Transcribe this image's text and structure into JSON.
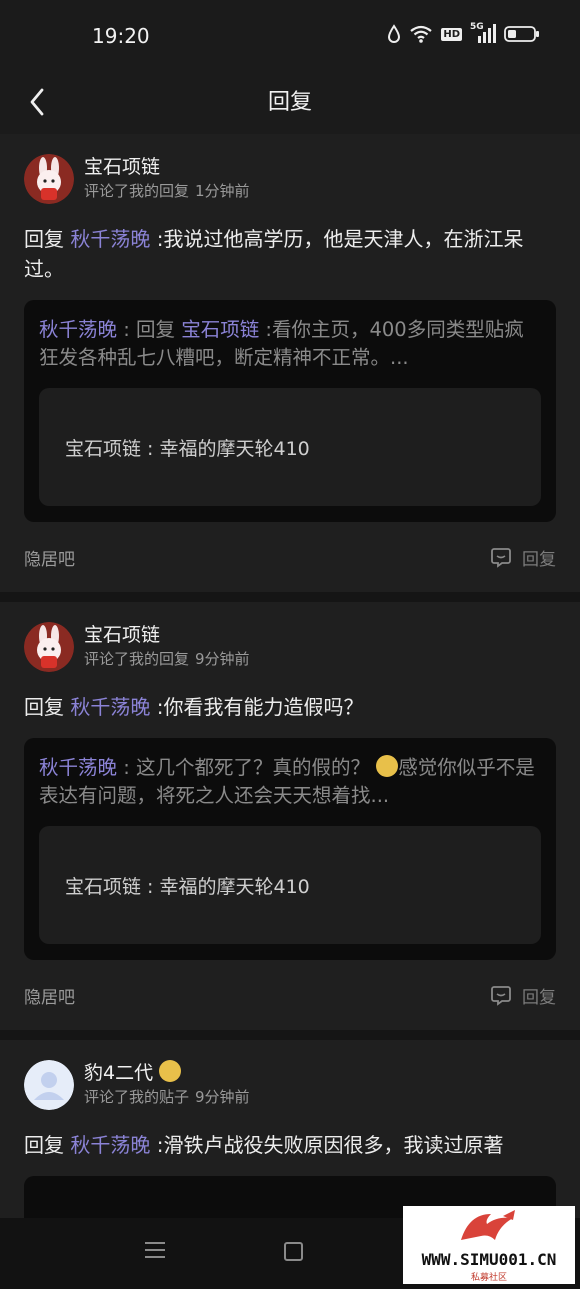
{
  "status": {
    "time": "19:20",
    "network": "5G",
    "hd": "HD"
  },
  "nav": {
    "title": "回复"
  },
  "cards": [
    {
      "author": "宝石项链",
      "action": "评论了我的回复",
      "ago": "1分钟前",
      "reply_prefix": "回复",
      "mention": "秋千荡晚",
      "content": ":我说过他高学历，他是天津人，在浙江呆过。",
      "quote_author": "秋千荡晚",
      "quote_mid": " : 回复 ",
      "quote_mention": "宝石项链",
      "quote_text": " :看你主页，400多同类型贴疯狂发各种乱七八糟吧，断定精神不正常。...",
      "inner": "宝石项链 : 幸福的摩天轮410",
      "forum": "隐居吧",
      "reply_label": "回复"
    },
    {
      "author": "宝石项链",
      "action": "评论了我的回复",
      "ago": "9分钟前",
      "reply_prefix": "回复",
      "mention": "秋千荡晚",
      "content": ":你看我有能力造假吗？",
      "quote_author": "秋千荡晚",
      "quote_text_a": " : 这几个都死了？真的假的？",
      "quote_text_b": "感觉你似乎不是表达有问题，将死之人还会天天想着找...",
      "inner": "宝石项链 : 幸福的摩天轮410",
      "forum": "隐居吧",
      "reply_label": "回复"
    },
    {
      "author": "豹4二代",
      "action": "评论了我的贴子",
      "ago": "9分钟前",
      "reply_prefix": "回复",
      "mention": "秋千荡晚",
      "content": ":滑铁卢战役失败原因很多，我读过原著"
    }
  ],
  "watermark": {
    "site": "WWW.SIMU001.CN",
    "label": "私募社区"
  }
}
